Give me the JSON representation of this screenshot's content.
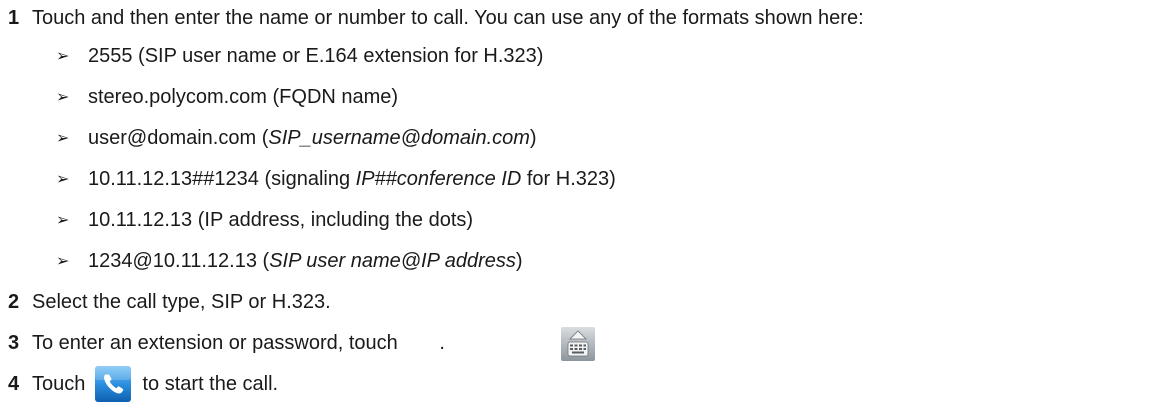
{
  "steps": [
    {
      "num": "1",
      "text": "Touch and then enter the name or number to call. You can use any of the formats shown here:",
      "bullets": [
        {
          "text": "2555 (SIP user name or E.164 extension for H.323)"
        },
        {
          "text": "stereo.polycom.com (FQDN name)"
        },
        {
          "pre": "user@domain.com (",
          "em": "SIP_username@domain.com",
          "post": ")"
        },
        {
          "pre": "10.11.12.13##1234 (signaling ",
          "em": "IP##conference ID",
          "post": " for H.323)"
        },
        {
          "text": "10.11.12.13 (IP address, including the dots)"
        },
        {
          "pre": "1234@10.11.12.13 (",
          "em": "SIP user name@IP address",
          "post": ")"
        }
      ]
    },
    {
      "num": "2",
      "text": "Select the call type, SIP or H.323."
    },
    {
      "num": "3",
      "pre": "To enter an extension or password, touch ",
      "post": "."
    },
    {
      "num": "4",
      "pre": "Touch ",
      "post": " to start the call."
    }
  ],
  "bullet_glyph": "➢",
  "icons": {
    "keyboard": "keyboard-icon",
    "call": "phone-call-icon"
  }
}
